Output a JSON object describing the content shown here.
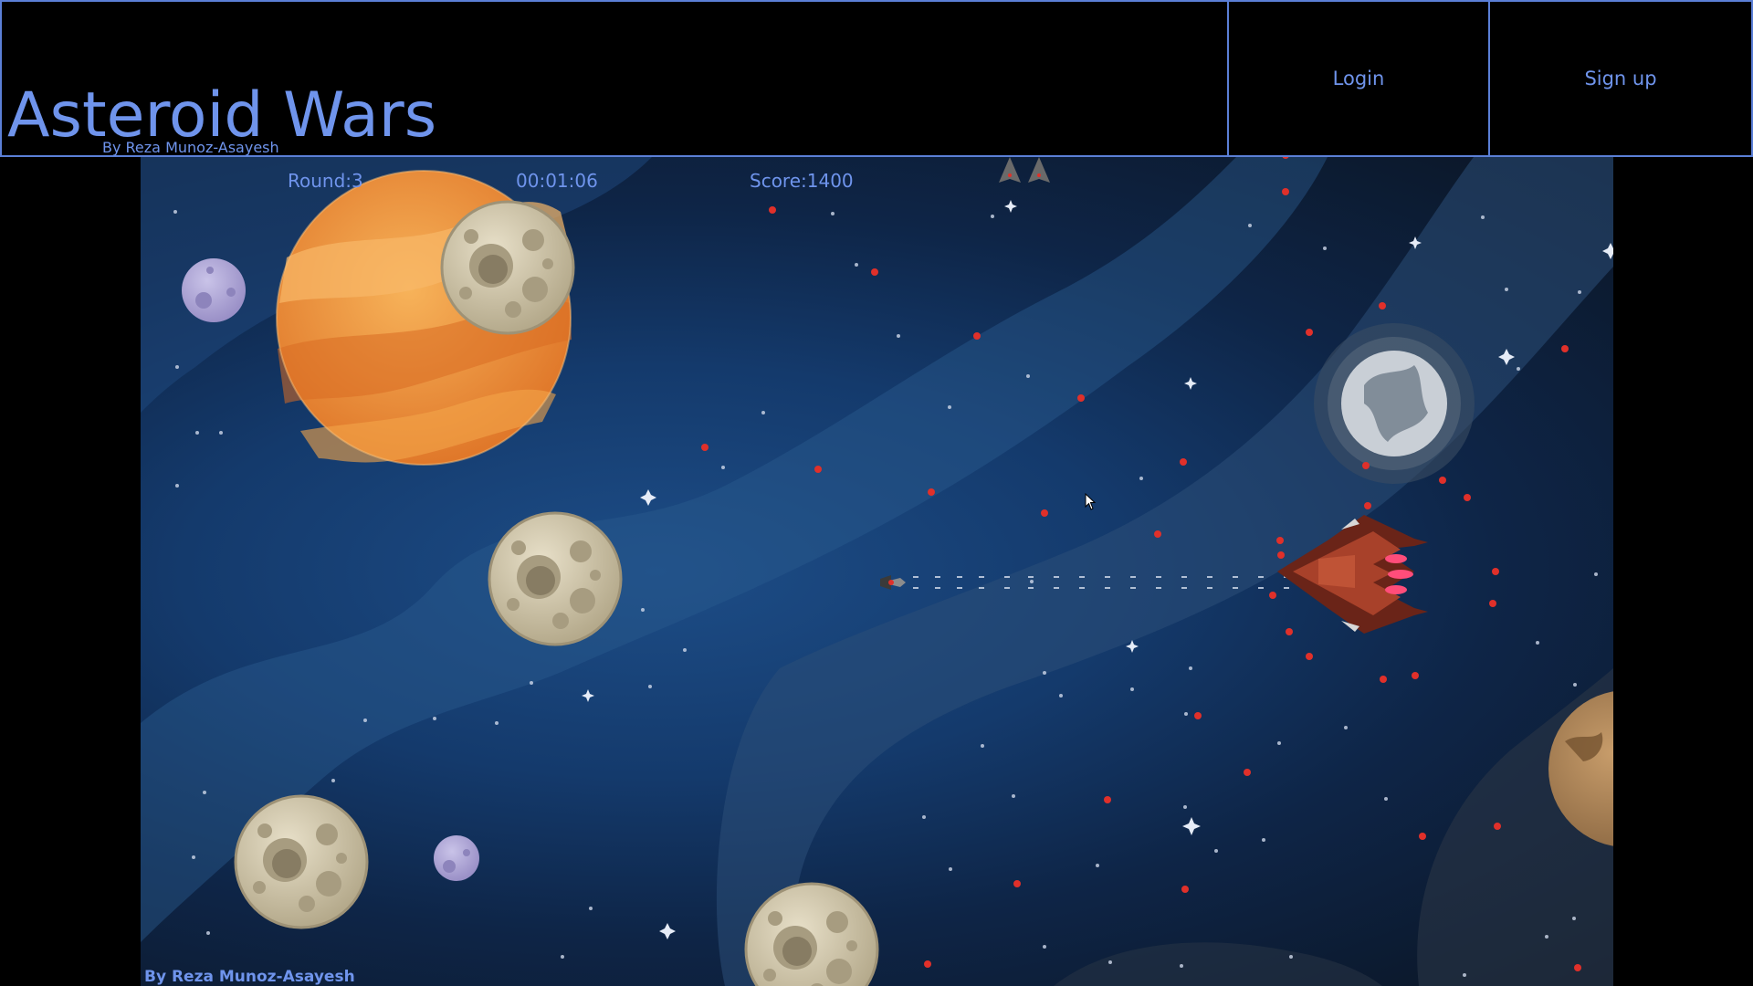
{
  "header": {
    "title": "Asteroid Wars",
    "subtitle": "By Reza Munoz-Asayesh",
    "nav": {
      "login_label": "Login",
      "signup_label": "Sign up"
    }
  },
  "hud": {
    "round": "Round:3",
    "timer": "00:01:06",
    "score": "Score:1400",
    "lives_remaining": 2
  },
  "game": {
    "footer_credit": "By Reza Munoz-Asayesh"
  },
  "colors": {
    "accent": "#6f94ec",
    "border": "#5b7fd6",
    "space_deep": "#0e2547",
    "enemy_bullet": "#e0302a",
    "gas_planet": "#f39a3a"
  }
}
